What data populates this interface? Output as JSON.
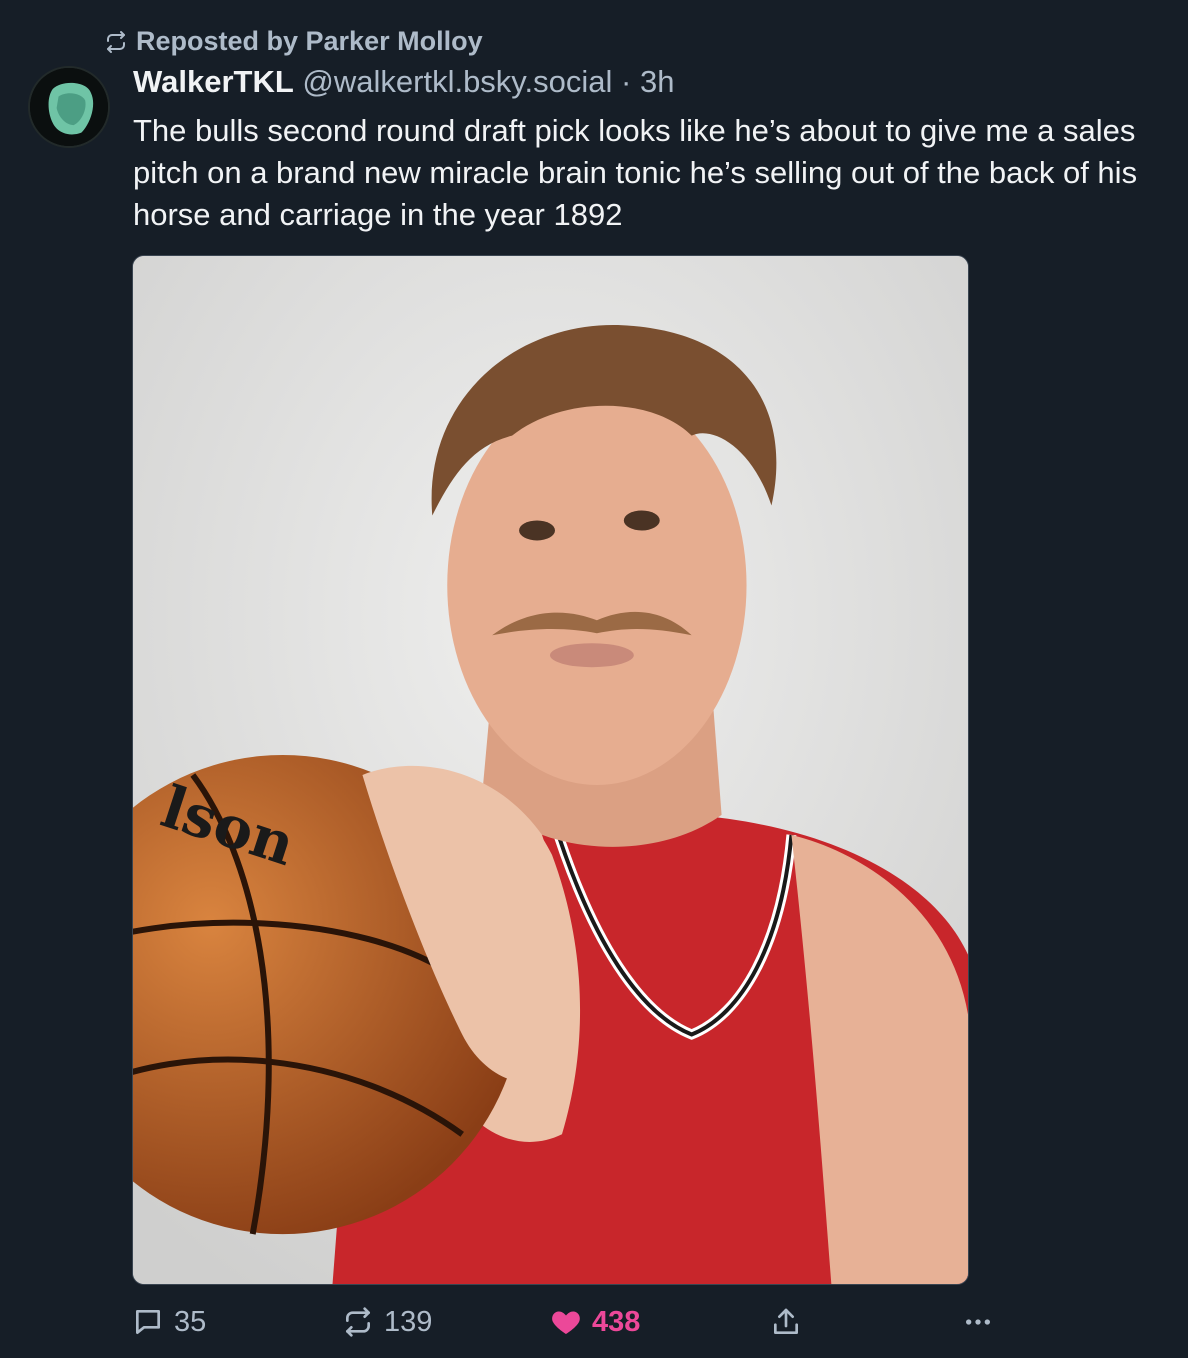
{
  "repost": {
    "label": "Reposted by Parker Molloy"
  },
  "author": {
    "display_name": "WalkerTKL",
    "handle": "@walkertkl.bsky.social",
    "separator": "·",
    "time": "3h"
  },
  "post": {
    "text": "The bulls second round draft pick looks like he’s about to give me a sales pitch on a brand new miracle brain tonic he’s selling out of the back of his horse and carriage in the year 1892"
  },
  "actions": {
    "replies": "35",
    "reposts": "139",
    "likes": "438"
  },
  "icons": {
    "repost": "repost-icon",
    "reply": "reply-icon",
    "like": "heart-icon",
    "share": "share-icon",
    "more": "more-icon"
  },
  "colors": {
    "background": "#161e27",
    "muted_text": "#aebbc9",
    "like_pink": "#ec4899"
  }
}
